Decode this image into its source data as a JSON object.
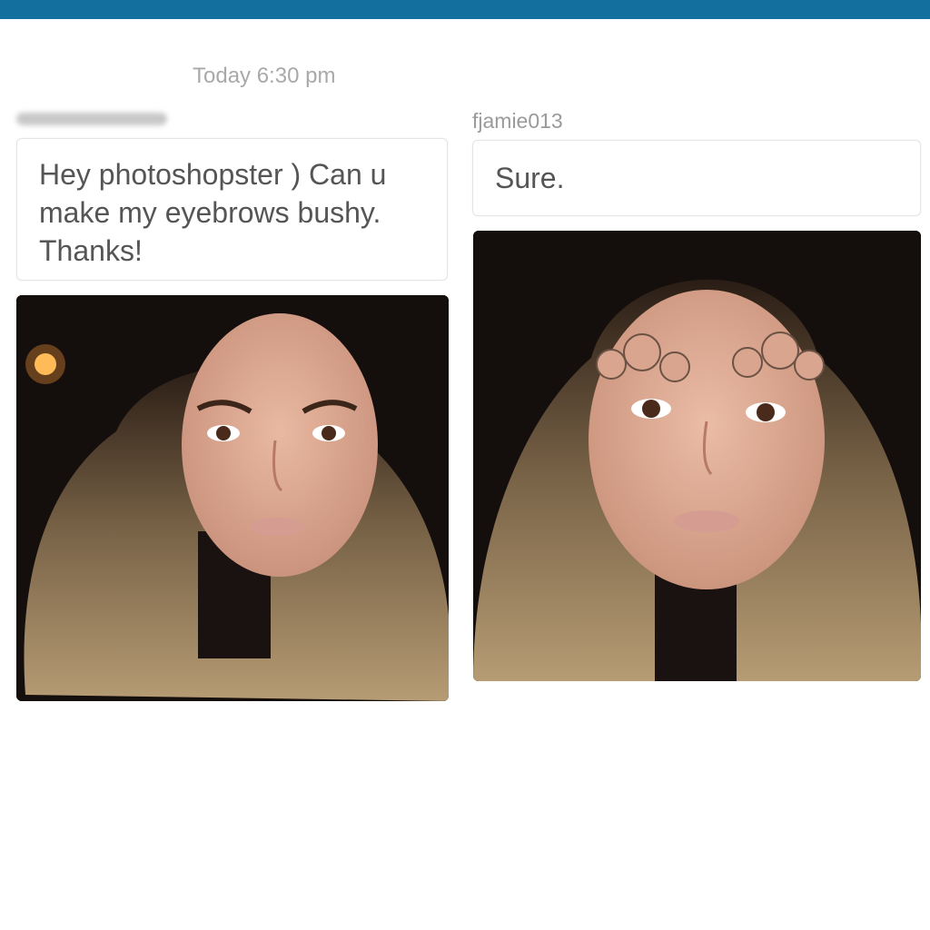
{
  "header": {
    "bar_color": "#136f9e"
  },
  "conversation": {
    "timestamp": "Today 6:30 pm",
    "left": {
      "sender_name_redacted": true,
      "message": "Hey photoshopster ) Can u make my eyebrows bushy. Thanks!",
      "photo": {
        "icon": "portrait-photo-original"
      }
    },
    "right": {
      "sender": "fjamie013",
      "message": "Sure.",
      "photo": {
        "icon": "portrait-photo-edited"
      }
    }
  }
}
